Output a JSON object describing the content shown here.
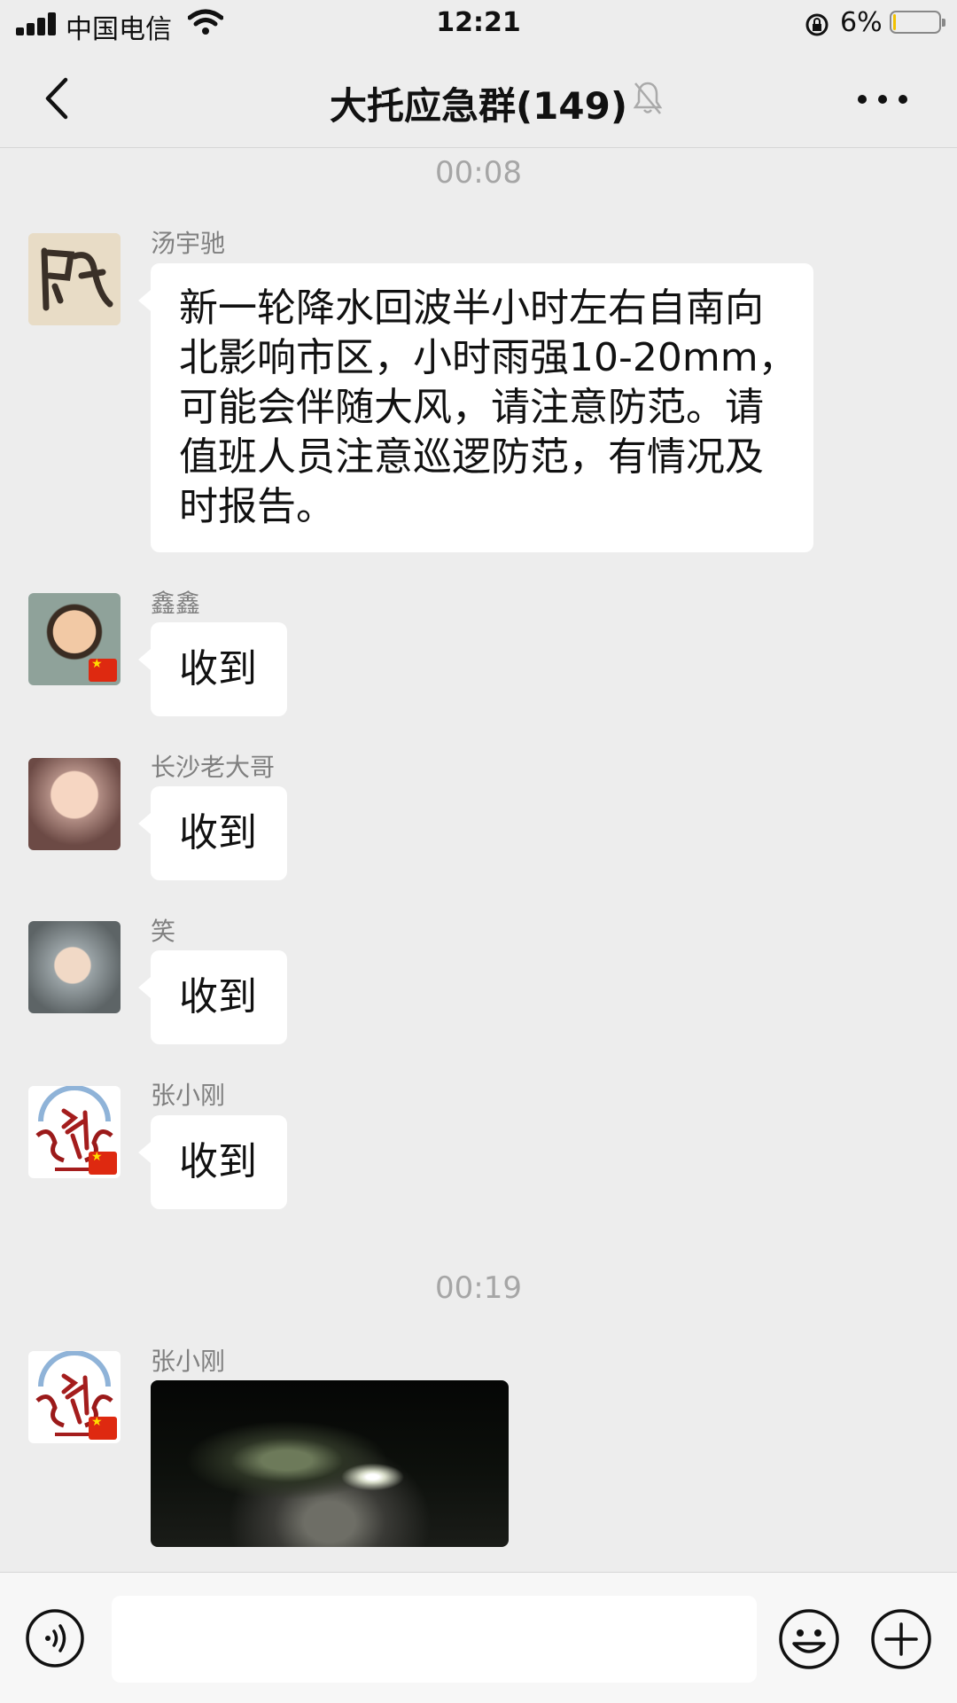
{
  "status_bar": {
    "carrier": "中国电信",
    "time": "12:21",
    "battery": "6%",
    "battery_level": 0.06,
    "icons": [
      "signal-icon",
      "wifi-icon",
      "rotation-lock-icon",
      "battery-icon"
    ]
  },
  "header": {
    "title": "大托应急群(149)",
    "icons": [
      "back-icon",
      "mute-bell-icon",
      "more-icon"
    ]
  },
  "messages": [
    {
      "type": "time",
      "text": "00:08"
    },
    {
      "sender": "汤宇驰",
      "text": "新一轮降水回波半小时左右自南向北影响市区，小时雨强10-20mm，可能会伴随大风，请注意防范。请值班人员注意巡逻防范，有情况及时报告。",
      "lines": [
        "新一轮降水回波半小时左右自南向",
        "北影响市区，小时雨强10-20mm，",
        "可能会伴随大风，请注意防范。请",
        "值班人员注意巡逻防范，有情况及",
        "时报告。"
      ]
    },
    {
      "sender": "鑫鑫",
      "text": "收到"
    },
    {
      "sender": "长沙老大哥",
      "text": "收到"
    },
    {
      "sender": "笑",
      "text": "收到"
    },
    {
      "sender": "张小刚",
      "text": "收到"
    },
    {
      "type": "time",
      "text": "00:19"
    },
    {
      "sender": "张小刚",
      "type": "image"
    }
  ],
  "input_bar": {
    "placeholder": "",
    "icons": [
      "voice-icon",
      "emoji-icon",
      "plus-icon"
    ]
  },
  "colors": {
    "background": "#ededed",
    "bubble": "#ffffff",
    "timestamp": "#a6a6a6",
    "sender_name": "#808080",
    "battery_fill": "#f2c200",
    "flag_red": "#de2910"
  }
}
